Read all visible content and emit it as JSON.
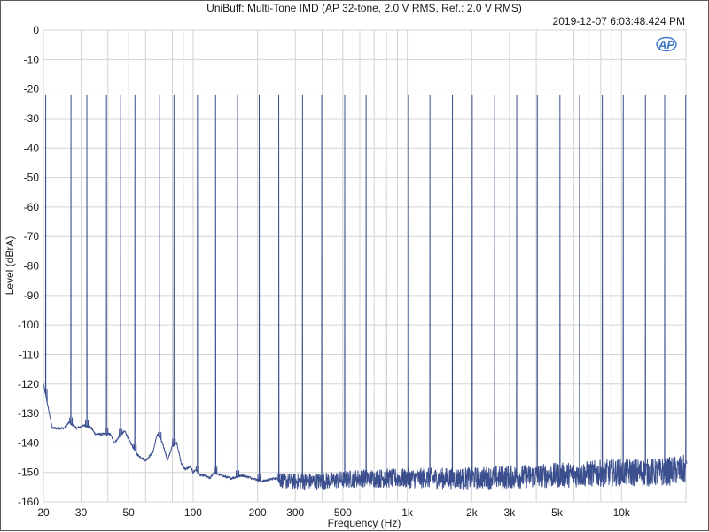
{
  "chart_data": {
    "type": "line",
    "title": "UniBuff: Multi-Tone IMD (AP 32-tone, 2.0 V RMS, Ref.: 2.0 V RMS)",
    "timestamp": "2019-12-07 6:03:48.424 PM",
    "logo_text": "AP",
    "xlabel": "Frequency (Hz)",
    "ylabel": "Level (dBrA)",
    "x_scale": "log",
    "xlim": [
      20,
      20000
    ],
    "ylim": [
      -160,
      0
    ],
    "x_ticks": [
      {
        "value": 20,
        "label": "20"
      },
      {
        "value": 30,
        "label": "30"
      },
      {
        "value": 50,
        "label": "50"
      },
      {
        "value": 100,
        "label": "100"
      },
      {
        "value": 200,
        "label": "200"
      },
      {
        "value": 300,
        "label": "300"
      },
      {
        "value": 500,
        "label": "500"
      },
      {
        "value": 1000,
        "label": "1k"
      },
      {
        "value": 2000,
        "label": "2k"
      },
      {
        "value": 3000,
        "label": "3k"
      },
      {
        "value": 5000,
        "label": "5k"
      },
      {
        "value": 10000,
        "label": "10k"
      }
    ],
    "y_ticks": [
      0,
      -10,
      -20,
      -30,
      -40,
      -50,
      -60,
      -70,
      -80,
      -90,
      -100,
      -110,
      -120,
      -130,
      -140,
      -150,
      -160
    ],
    "grid": true,
    "line_color": "#3b4f8e",
    "series": [
      {
        "tone_frequencies_hz": [
          20.5,
          26.9,
          31.9,
          39.4,
          45.9,
          53.5,
          69.8,
          81.4,
          104.8,
          127.3,
          161.2,
          203.5,
          251.1,
          324.3,
          398.6,
          510.4,
          642.3,
          794.8,
          1012.7,
          1276.1,
          1625.0,
          2010.6,
          2558.7,
          3243.3,
          4046.3,
          5161.2,
          6373.9,
          8137.4,
          10194.1,
          12935.8,
          15917.8,
          19953.2
        ],
        "tone_level_db": -22,
        "noise_floor_db": [
          [
            20,
            -120
          ],
          [
            21.3,
            -130
          ],
          [
            22,
            -135
          ],
          [
            25,
            -135
          ],
          [
            26.4,
            -133
          ],
          [
            28.5,
            -135
          ],
          [
            31.2,
            -134
          ],
          [
            33.5,
            -135
          ],
          [
            35,
            -137
          ],
          [
            38.6,
            -137
          ],
          [
            41,
            -137
          ],
          [
            43,
            -140
          ],
          [
            45,
            -138
          ],
          [
            48,
            -136
          ],
          [
            51,
            -140
          ],
          [
            55,
            -144
          ],
          [
            60,
            -146
          ],
          [
            65,
            -143
          ],
          [
            68,
            -137
          ],
          [
            72,
            -140
          ],
          [
            76,
            -146
          ],
          [
            80,
            -141
          ],
          [
            84,
            -140
          ],
          [
            88,
            -147
          ],
          [
            92,
            -149
          ],
          [
            97,
            -148
          ],
          [
            100,
            -150
          ],
          [
            103,
            -149
          ],
          [
            107,
            -151
          ],
          [
            112,
            -151
          ],
          [
            120,
            -152
          ],
          [
            125,
            -150
          ],
          [
            135,
            -151
          ],
          [
            150,
            -152
          ],
          [
            170,
            -151
          ],
          [
            190,
            -152
          ],
          [
            210,
            -153
          ],
          [
            240,
            -152
          ],
          [
            270,
            -153
          ],
          [
            300,
            -153
          ],
          [
            400,
            -153
          ],
          [
            600,
            -152
          ],
          [
            1000,
            -152
          ],
          [
            2000,
            -152
          ],
          [
            5000,
            -151
          ],
          [
            10000,
            -150
          ],
          [
            15000,
            -150
          ],
          [
            20000,
            -149
          ]
        ]
      }
    ]
  }
}
